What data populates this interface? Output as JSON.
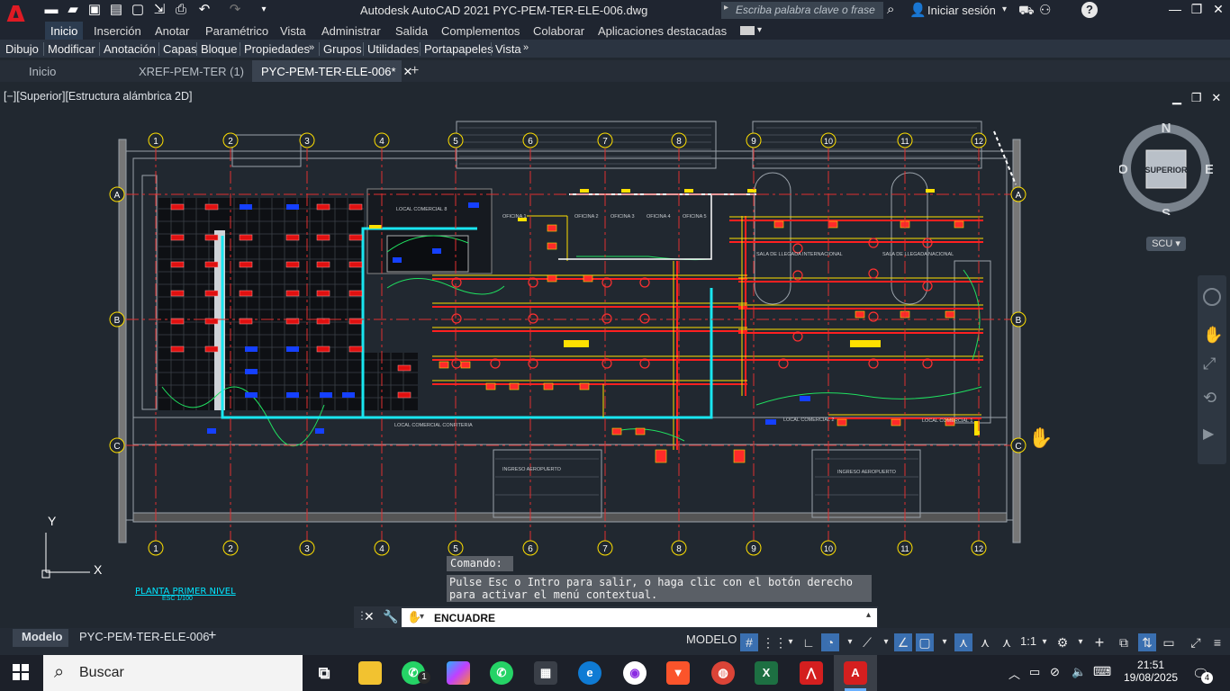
{
  "titlebar": {
    "app_title": "Autodesk AutoCAD 2021   PYC-PEM-TER-ELE-006.dwg",
    "search_placeholder": "Escriba palabra clave o frase",
    "user": "Iniciar sesión",
    "logo": "A"
  },
  "menus": [
    "Inicio",
    "Inserción",
    "Anotar",
    "Paramétrico",
    "Vista",
    "Administrar",
    "Salida",
    "Complementos",
    "Colaborar",
    "Aplicaciones destacadas"
  ],
  "panels": [
    "Dibujo",
    "Modificar",
    "Anotación",
    "Capas",
    "Bloque",
    "Propiedades",
    "Grupos",
    "Utilidades",
    "Portapapeles",
    "Vista"
  ],
  "file_tabs": [
    {
      "label": "Inicio"
    },
    {
      "label": "XREF-PEM-TER (1)"
    },
    {
      "label": "PYC-PEM-TER-ELE-006*"
    }
  ],
  "view_label": "[−][Superior][Estructura alámbrica 2D]",
  "grid": {
    "columns": [
      "1",
      "2",
      "3",
      "4",
      "5",
      "6",
      "7",
      "8",
      "9",
      "10",
      "11",
      "12"
    ],
    "rows": [
      "A",
      "B",
      "C"
    ]
  },
  "room_labels": [
    "LOCAL COMERCIAL 8",
    "LOCAL COMERCIAL CONFITERIA",
    "INGRESO AEROPUERTO",
    "INGRESO AEROPUERTO",
    "LOCAL COMERCIAL 1",
    "LOCAL COMERCIAL 2",
    "SALA DE LLEGADA INTERNACIONAL",
    "SALA DE LLEGADA NACIONAL",
    "OFICINA 1",
    "OFICINA 2",
    "OFICINA 3",
    "OFICINA 4",
    "OFICINA 5"
  ],
  "plan": {
    "title": "PLANTA PRIMER NIVEL",
    "scale": "ESC 1/100"
  },
  "nav_cube": {
    "top": "SUPERIOR",
    "n": "N",
    "s": "S",
    "e": "E",
    "o": "O",
    "scu": "SCU"
  },
  "ucs": {
    "x": "X",
    "y": "Y"
  },
  "command": {
    "history": "Comando:",
    "message": "Pulse Esc o Intro para salir, o haga clic con el botón derecho para activar el menú contextual.",
    "input": "ENCUADRE"
  },
  "status": {
    "tabs": [
      "Modelo",
      "PYC-PEM-TER-ELE-006"
    ],
    "mode": "MODELO",
    "scale": "1:1"
  },
  "taskbar": {
    "search": "Buscar",
    "time": "21:51",
    "date": "19/08/2025",
    "notifications": "4",
    "whatsapp_badge": "1"
  },
  "colors": {
    "accent": "#2c3c50",
    "autocad_red": "#e01b24",
    "cyan_polyline": "#19e6f0",
    "conduit_red": "#ff2020",
    "conduit_yellow": "#ffe000"
  }
}
